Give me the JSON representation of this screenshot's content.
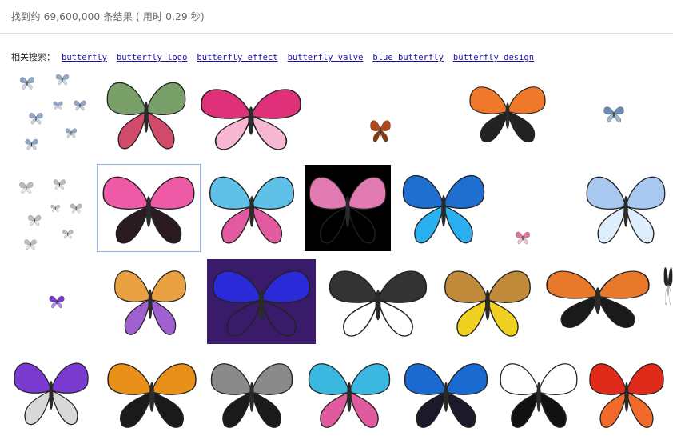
{
  "stats": {
    "text": "找到约 69,600,000 条结果 ( 用时 0.29 秒)"
  },
  "related": {
    "label": "相关搜索：",
    "links": [
      "butterfly",
      "butterfly logo",
      "butterfly effect",
      "butterfly valve",
      "blue butterfly",
      "butterfly design"
    ]
  },
  "images": [
    {
      "name": "small-butterflies-flock",
      "colors": [
        "#8fa8c8",
        "#cfd8e2"
      ]
    },
    {
      "name": "green-pink-butterfly",
      "colors": [
        "#7aa06a",
        "#d24a6a"
      ]
    },
    {
      "name": "pink-butterfly-flowers-frame",
      "colors": [
        "#e0307a",
        "#f7b6d2"
      ]
    },
    {
      "name": "tiny-brown-butterfly",
      "colors": [
        "#b04a1a",
        "#8a3a10"
      ]
    },
    {
      "name": "orange-monarch-butterfly",
      "colors": [
        "#f0782a",
        "#222222"
      ]
    },
    {
      "name": "small-blue-butterfly",
      "colors": [
        "#6a8cb0",
        "#9fb6cc"
      ]
    },
    {
      "name": "white-butterflies-group",
      "colors": [
        "#bdbdbd",
        "#e6e6e6"
      ]
    },
    {
      "name": "pink-butterfly-selected",
      "colors": [
        "#ee5aa6",
        "#2a1a22"
      ]
    },
    {
      "name": "cartoon-colorful-butterfly",
      "colors": [
        "#5fc1e8",
        "#e25aa0"
      ]
    },
    {
      "name": "pink-roses-butterfly",
      "colors": [
        "#e07ab0",
        "#000000"
      ]
    },
    {
      "name": "blue-morpho-butterfly",
      "colors": [
        "#1e6fd0",
        "#2ab0f0"
      ]
    },
    {
      "name": "tiny-pink-butterfly",
      "colors": [
        "#e07a9a",
        "#f2c4d2"
      ]
    },
    {
      "name": "light-blue-glitter-butterfly",
      "colors": [
        "#a8c8f0",
        "#dfeefc"
      ]
    },
    {
      "name": "tiny-purple-butterfly",
      "colors": [
        "#7a3ad0",
        "#b08af0"
      ]
    },
    {
      "name": "gradient-wing-butterfly",
      "colors": [
        "#e8a040",
        "#a060d0"
      ]
    },
    {
      "name": "neon-butterfly-purple-bg",
      "colors": [
        "#2a2ad8",
        "#3a1a6a"
      ]
    },
    {
      "name": "fairy-butterfly-sketch",
      "colors": [
        "#333333",
        "#ffffff"
      ]
    },
    {
      "name": "butterfly-flowers-rock",
      "colors": [
        "#c08a3a",
        "#f0d020"
      ]
    },
    {
      "name": "orange-monarch-shadow",
      "colors": [
        "#e8782a",
        "#1a1a1a"
      ]
    },
    {
      "name": "partial-black-butterfly",
      "colors": [
        "#222222",
        "#ffffff"
      ]
    },
    {
      "name": "butterfly-martini-glass",
      "colors": [
        "#7a3ad0",
        "#d8d8d8"
      ]
    },
    {
      "name": "orange-butterfly-side",
      "colors": [
        "#e8901a",
        "#1a1a1a"
      ]
    },
    {
      "name": "gray-butterfly",
      "colors": [
        "#8a8a8a",
        "#1a1a1a"
      ]
    },
    {
      "name": "jeweled-pink-blue-butterfly",
      "colors": [
        "#3ab8e0",
        "#e05aa0"
      ]
    },
    {
      "name": "dark-blue-butterfly",
      "colors": [
        "#1a6ad0",
        "#1a1a2a"
      ]
    },
    {
      "name": "outline-butterfly-drawing",
      "colors": [
        "#ffffff",
        "#111111"
      ]
    },
    {
      "name": "red-glitter-butterfly",
      "colors": [
        "#e02a1a",
        "#f06a2a"
      ]
    }
  ]
}
